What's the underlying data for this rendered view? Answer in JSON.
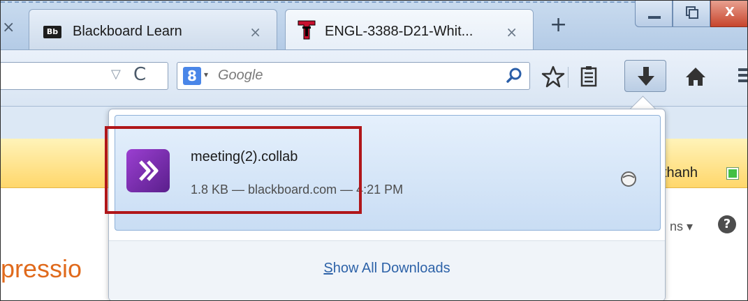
{
  "tabs": [
    {
      "title": "Blackboard Learn",
      "favicon": "Bb",
      "close": "×"
    },
    {
      "title": "ENGL-3388-D21-Whit...",
      "favicon": "texas-tech-icon",
      "close": "×"
    }
  ],
  "tabstrip": {
    "edge_close": "×",
    "new_tab": "+"
  },
  "window_controls": {
    "close": "X"
  },
  "navbar": {
    "url_dropdown": "▽",
    "reload": "C",
    "search_engine": "8",
    "search_dropdown": "▾",
    "search_placeholder": "Google"
  },
  "background_page": {
    "user": "thanh",
    "options": "ns ▾",
    "help": "?",
    "heading_fragment": "pressio"
  },
  "downloads_panel": {
    "items": [
      {
        "name": "meeting(2).collab",
        "meta": "1.8 KB — blackboard.com — 4:21 PM",
        "icon": "collab-app-icon"
      }
    ],
    "show_all_prefix": "S",
    "show_all_rest": "how All Downloads"
  },
  "colors": {
    "highlight_border": "#b0161a",
    "accent_link": "#2d62a8",
    "item_bg": "#c9ddf4",
    "orange_band": "#ffd76b"
  }
}
